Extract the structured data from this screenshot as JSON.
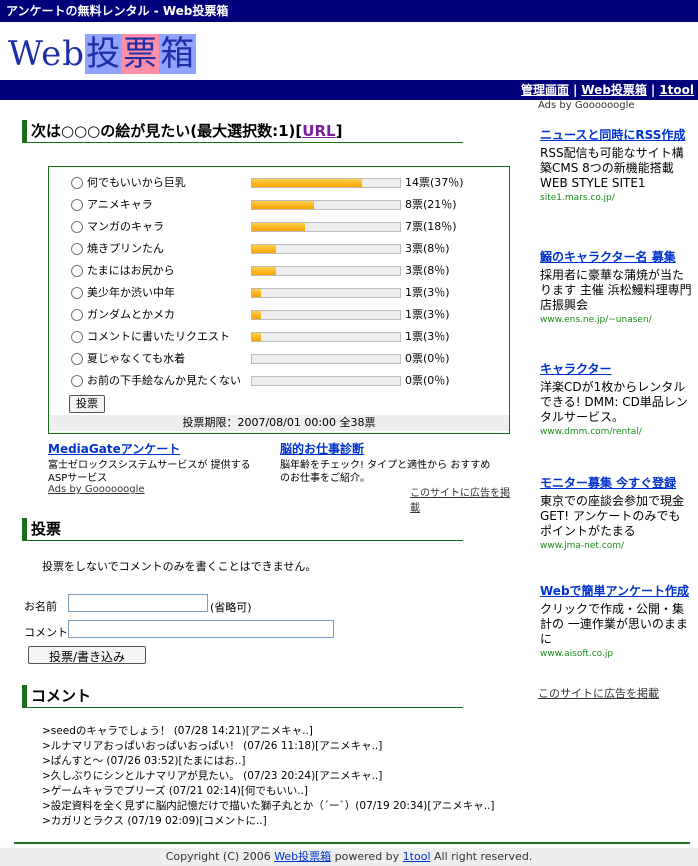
{
  "topbar": {
    "title": "アンケートの無料レンタル - Web投票箱"
  },
  "logo": {
    "part1": "Web",
    "k1": "投",
    "k2": "票",
    "k3": "箱"
  },
  "nav": {
    "items": [
      "管理画面",
      "Web投票箱",
      "1tool"
    ],
    "separator": "|"
  },
  "poll": {
    "title": "次は○○○の絵が見たい(最大選択数:1)",
    "title_bracket_open": "[",
    "title_link": "URL",
    "title_bracket_close": "]",
    "options": [
      {
        "label": "何でもいいから巨乳",
        "count": "14票(37％)",
        "fraction": 0.74
      },
      {
        "label": "アニメキャラ",
        "count": "8票(21％)",
        "fraction": 0.42
      },
      {
        "label": "マンガのキャラ",
        "count": "7票(18％)",
        "fraction": 0.36
      },
      {
        "label": "焼きプリンたん",
        "count": "3票(8％)",
        "fraction": 0.16
      },
      {
        "label": "たまにはお尻から",
        "count": "3票(8％)",
        "fraction": 0.16
      },
      {
        "label": "美少年か渋い中年",
        "count": "1票(3％)",
        "fraction": 0.06
      },
      {
        "label": "ガンダムとかメカ",
        "count": "1票(3％)",
        "fraction": 0.06
      },
      {
        "label": "コメントに書いたリクエスト",
        "count": "1票(3％)",
        "fraction": 0.06
      },
      {
        "label": "夏じゃなくても水着",
        "count": "0票(0％)",
        "fraction": 0.0
      },
      {
        "label": "お前の下手絵なんか見たくない",
        "count": "0票(0％)",
        "fraction": 0.0
      }
    ],
    "vote_button": "投票",
    "deadline": "投票期限：2007/08/01 00:00 全38票"
  },
  "ads": {
    "ad1": {
      "title": "MediaGateアンケート",
      "text": "富士ゼロックスシステムサービスが 提供するASPサービス"
    },
    "ad2": {
      "title": "脳的お仕事診断",
      "text": "脳年齢をチェック! タイプと適性から おすすめのお仕事をご紹介。"
    },
    "ads_by": "Ads by Goooooogle",
    "this_site": "このサイトに広告を掲載"
  },
  "vote_section": {
    "heading": "投票",
    "note": "投票をしないでコメントのみを書くことはできません。",
    "name_label": "お名前",
    "name_hint": "(省略可)",
    "comment_label": "コメント",
    "submit": "投票/書き込み"
  },
  "comments": {
    "heading": "コメント",
    "items": [
      ">seedのキャラでしょう！ (07/28 14:21)[アニメキャ..]",
      ">ルナマリアおっぱいおっぱいおっぱい！ (07/26 11:18)[アニメキャ..]",
      ">ぱんすと～ (07/26 03:52)[たまにはお..]",
      ">久しぶりにシンとルナマリアが見たい。 (07/23 20:24)[アニメキャ..]",
      ">ゲームキャラでプリーズ (07/21 02:14)[何でもいい..]",
      ">設定資料を全く見ずに脳内記憶だけで描いた獅子丸とか（´ー`）(07/19 20:34)[アニメキャ..]",
      ">カガリとラクス (07/19 02:09)[コメントに..]"
    ]
  },
  "sidebar": {
    "ads_by": "Ads by Goooooogle",
    "ads": [
      {
        "title": "ニュースと同時にRSS作成",
        "text": "RSS配信も可能なサイト構築CMS 8つの新機能搭載 WEB STYLE SITE1",
        "url": "site1.mars.co.jp/"
      },
      {
        "title": "鰯のキャラクター名 募集",
        "text": "採用者に豪華な蒲焼が当たります 主催 浜松鰻料理専門店振興会",
        "url": "www.ens.ne.jp/~unasen/"
      },
      {
        "title": "キャラクター",
        "text": "洋楽CDが1枚からレンタルできる! DMM: CD単品レンタルサービス。",
        "url": "www.dmm.com/rental/"
      },
      {
        "title": "モニター募集 今すぐ登録",
        "text": "東京での座談会参加で現金GET! アンケートのみでもポイントがたまる",
        "url": "www.jma-net.com/"
      },
      {
        "title": "Webで簡単アンケート作成",
        "text": "クリックで作成・公開・集計の 一連作業が思いのままに",
        "url": "www.aisoft.co.jp"
      }
    ],
    "this_site": "このサイトに広告を掲載"
  },
  "footer": {
    "pre": "Copyright (C) 2006 ",
    "link1": "Web投票箱",
    "mid": " powered by ",
    "link2": "1tool",
    "post": " All right reserved."
  }
}
